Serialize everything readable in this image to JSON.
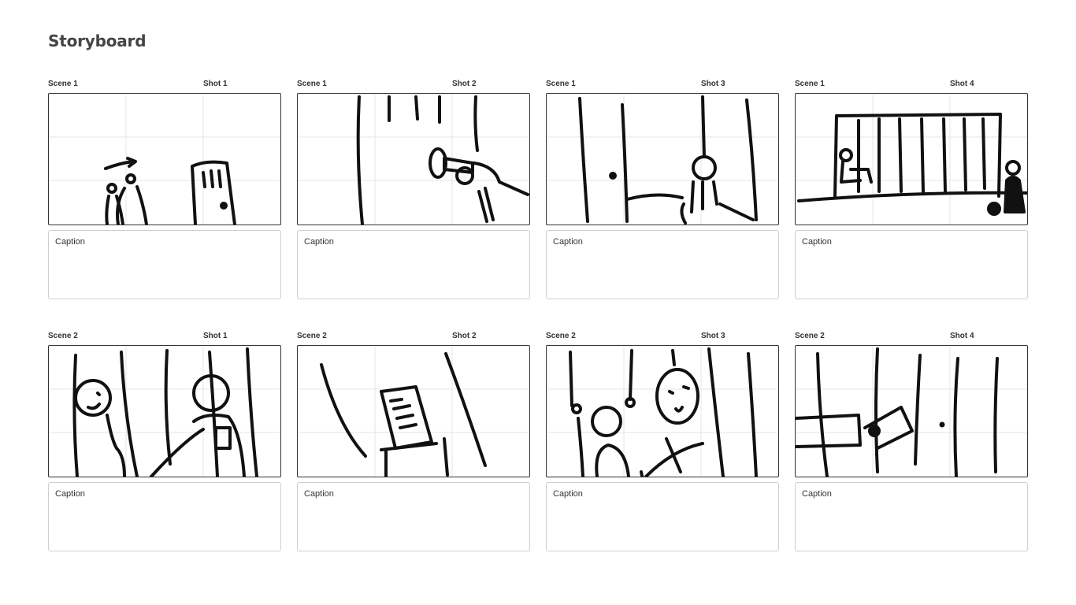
{
  "page": {
    "title": "Storyboard"
  },
  "caption_placeholder": "Caption",
  "rows": [
    {
      "shots": [
        {
          "scene": "Scene 1",
          "shot": "Shot 1",
          "caption": "Caption"
        },
        {
          "scene": "Scene 1",
          "shot": "Shot 2",
          "caption": "Caption"
        },
        {
          "scene": "Scene 1",
          "shot": "Shot 3",
          "caption": "Caption"
        },
        {
          "scene": "Scene 1",
          "shot": "Shot 4",
          "caption": "Caption"
        }
      ]
    },
    {
      "shots": [
        {
          "scene": "Scene 2",
          "shot": "Shot 1",
          "caption": "Caption"
        },
        {
          "scene": "Scene 2",
          "shot": "Shot 2",
          "caption": "Caption"
        },
        {
          "scene": "Scene 2",
          "shot": "Shot 3",
          "caption": "Caption"
        },
        {
          "scene": "Scene 2",
          "shot": "Shot 4",
          "caption": "Caption"
        }
      ]
    }
  ],
  "colors": {
    "ink": "#111111",
    "frame_border": "#333333",
    "caption_border": "#cfcfcf",
    "guide": "#e6e6e6"
  }
}
